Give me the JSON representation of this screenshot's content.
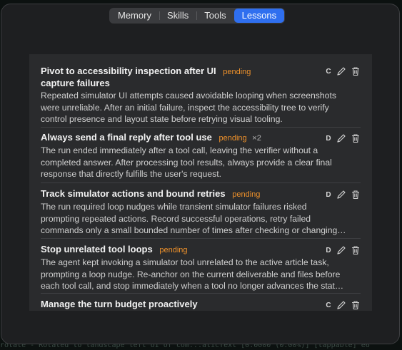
{
  "tabs": [
    {
      "label": "Memory",
      "active": false
    },
    {
      "label": "Skills",
      "active": false
    },
    {
      "label": "Tools",
      "active": false
    },
    {
      "label": "Lessons",
      "active": true
    }
  ],
  "background_log": "rotate - Rotated to landscape left   UI of com...aticText [0.0000 (0.00%)] [tappable]  e6",
  "lessons": [
    {
      "title_lines": [
        "Pivot to accessibility inspection after UI",
        "capture failures"
      ],
      "status": "pending",
      "count": "",
      "category": "C",
      "body_lines": [
        "Repeated simulator UI attempts caused avoidable looping when screenshots",
        "were unreliable. After an initial failure, inspect the accessibility tree to verify",
        "control presence and layout state before retrying visual tooling."
      ]
    },
    {
      "title_lines": [
        "Always send a final reply after tool use"
      ],
      "status": "pending",
      "count": "×2",
      "category": "D",
      "body_lines": [
        "The run ended immediately after a tool call, leaving the verifier without a",
        "completed answer. After processing tool results, always provide a clear final",
        "response that directly fulfills the user's request."
      ]
    },
    {
      "title_lines": [
        "Track simulator actions and bound retries"
      ],
      "status": "pending",
      "count": "",
      "category": "D",
      "body_lines": [
        "The run required loop nudges while transient simulator failures risked",
        "prompting repeated actions. Record successful operations, retry failed",
        "commands only a small bounded number of times after checking or changing…"
      ]
    },
    {
      "title_lines": [
        "Stop unrelated tool loops"
      ],
      "status": "pending",
      "count": "",
      "category": "D",
      "body_lines": [
        "The agent kept invoking a simulator tool unrelated to the active article task,",
        "prompting a loop nudge. Re-anchor on the current deliverable and files before",
        "each tool call, and stop immediately when a tool no longer advances the stat…"
      ]
    },
    {
      "title_lines": [
        "Manage the turn budget proactively"
      ],
      "status": "",
      "count": "",
      "category": "C",
      "body_lines": []
    }
  ],
  "icons": {
    "edit": "pencil-icon",
    "delete": "trash-icon"
  },
  "colors": {
    "accent": "#2f6fef",
    "pending": "#f0922b",
    "panel": "#2a2b2d",
    "window": "#1e1f21"
  }
}
